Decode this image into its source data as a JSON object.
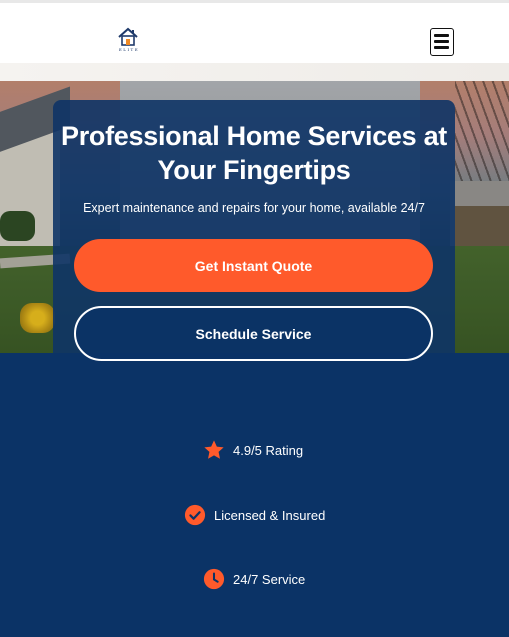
{
  "brand": {
    "logo_text": "ELITE",
    "accent_color": "#ff5a2b",
    "navy_color": "#0b3366"
  },
  "header": {
    "menu_icon": "hamburger-icon"
  },
  "hero": {
    "title": "Professional Home Services at Your Fingertips",
    "subtitle": "Expert maintenance and repairs for your home, available 24/7",
    "primary_button": "Get Instant Quote",
    "secondary_button": "Schedule Service"
  },
  "features": [
    {
      "icon": "star-icon",
      "label": "4.9/5 Rating"
    },
    {
      "icon": "check-circle-icon",
      "label": "Licensed & Insured"
    },
    {
      "icon": "clock-icon",
      "label": "24/7 Service"
    }
  ]
}
